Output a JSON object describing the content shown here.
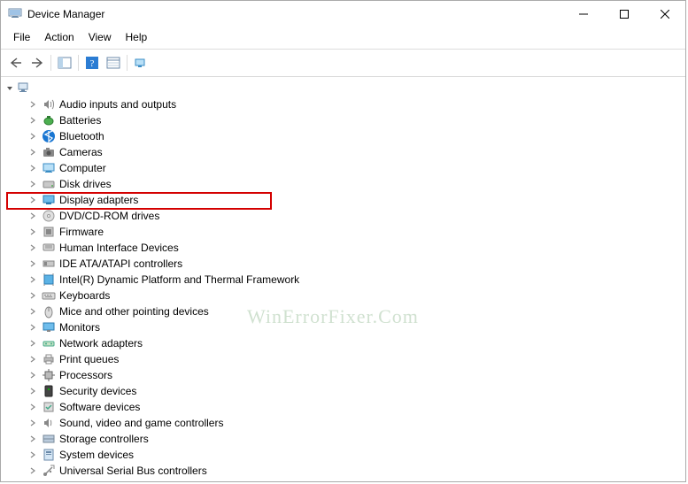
{
  "window": {
    "title": "Device Manager"
  },
  "menu": {
    "items": [
      {
        "label": "File"
      },
      {
        "label": "Action"
      },
      {
        "label": "View"
      },
      {
        "label": "Help"
      }
    ]
  },
  "devices": [
    {
      "name": "Audio inputs and outputs",
      "icon": "speaker"
    },
    {
      "name": "Batteries",
      "icon": "battery"
    },
    {
      "name": "Bluetooth",
      "icon": "bluetooth"
    },
    {
      "name": "Cameras",
      "icon": "camera"
    },
    {
      "name": "Computer",
      "icon": "computer"
    },
    {
      "name": "Disk drives",
      "icon": "disk"
    },
    {
      "name": "Display adapters",
      "icon": "display-adapter",
      "highlighted": true
    },
    {
      "name": "DVD/CD-ROM drives",
      "icon": "dvd"
    },
    {
      "name": "Firmware",
      "icon": "firmware"
    },
    {
      "name": "Human Interface Devices",
      "icon": "hid"
    },
    {
      "name": "IDE ATA/ATAPI controllers",
      "icon": "ide"
    },
    {
      "name": "Intel(R) Dynamic Platform and Thermal Framework",
      "icon": "intel"
    },
    {
      "name": "Keyboards",
      "icon": "keyboard"
    },
    {
      "name": "Mice and other pointing devices",
      "icon": "mouse"
    },
    {
      "name": "Monitors",
      "icon": "monitor"
    },
    {
      "name": "Network adapters",
      "icon": "network"
    },
    {
      "name": "Print queues",
      "icon": "printer"
    },
    {
      "name": "Processors",
      "icon": "cpu"
    },
    {
      "name": "Security devices",
      "icon": "security"
    },
    {
      "name": "Software devices",
      "icon": "software"
    },
    {
      "name": "Sound, video and game controllers",
      "icon": "sound"
    },
    {
      "name": "Storage controllers",
      "icon": "storage"
    },
    {
      "name": "System devices",
      "icon": "system"
    },
    {
      "name": "Universal Serial Bus controllers",
      "icon": "usb"
    }
  ],
  "watermark": "WinErrorFixer.Com"
}
